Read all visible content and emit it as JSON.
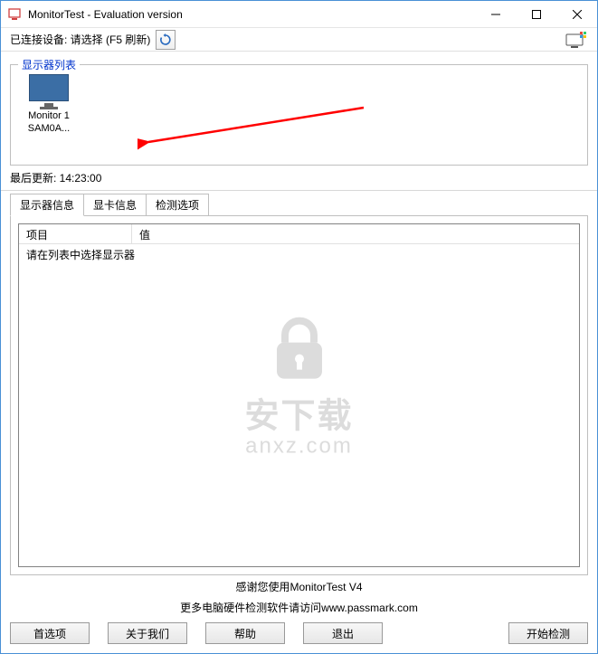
{
  "titlebar": {
    "title": "MonitorTest - Evaluation version"
  },
  "device_row": {
    "label": "已连接设备: 请选择 (F5 刷新)"
  },
  "monitor_panel": {
    "title": "显示器列表",
    "items": [
      {
        "line1": "Monitor 1",
        "line2": "SAM0A..."
      }
    ]
  },
  "last_update": "最后更新: 14:23:00",
  "tabs": [
    {
      "label": "显示器信息"
    },
    {
      "label": "显卡信息"
    },
    {
      "label": "检测选项"
    }
  ],
  "listview": {
    "col1": "项目",
    "col2": "值",
    "placeholder": "请在列表中选择显示器"
  },
  "watermark": {
    "text1": "安下载",
    "text2": "anxz.com"
  },
  "footer": {
    "line1": "感谢您使用MonitorTest V4",
    "line2_prefix": "更多电脑硬件检测软件请访问",
    "line2_link": "www.passmark.com"
  },
  "buttons": {
    "prefs": "首选项",
    "about": "关于我们",
    "help": "帮助",
    "exit": "退出",
    "start": "开始检测"
  }
}
